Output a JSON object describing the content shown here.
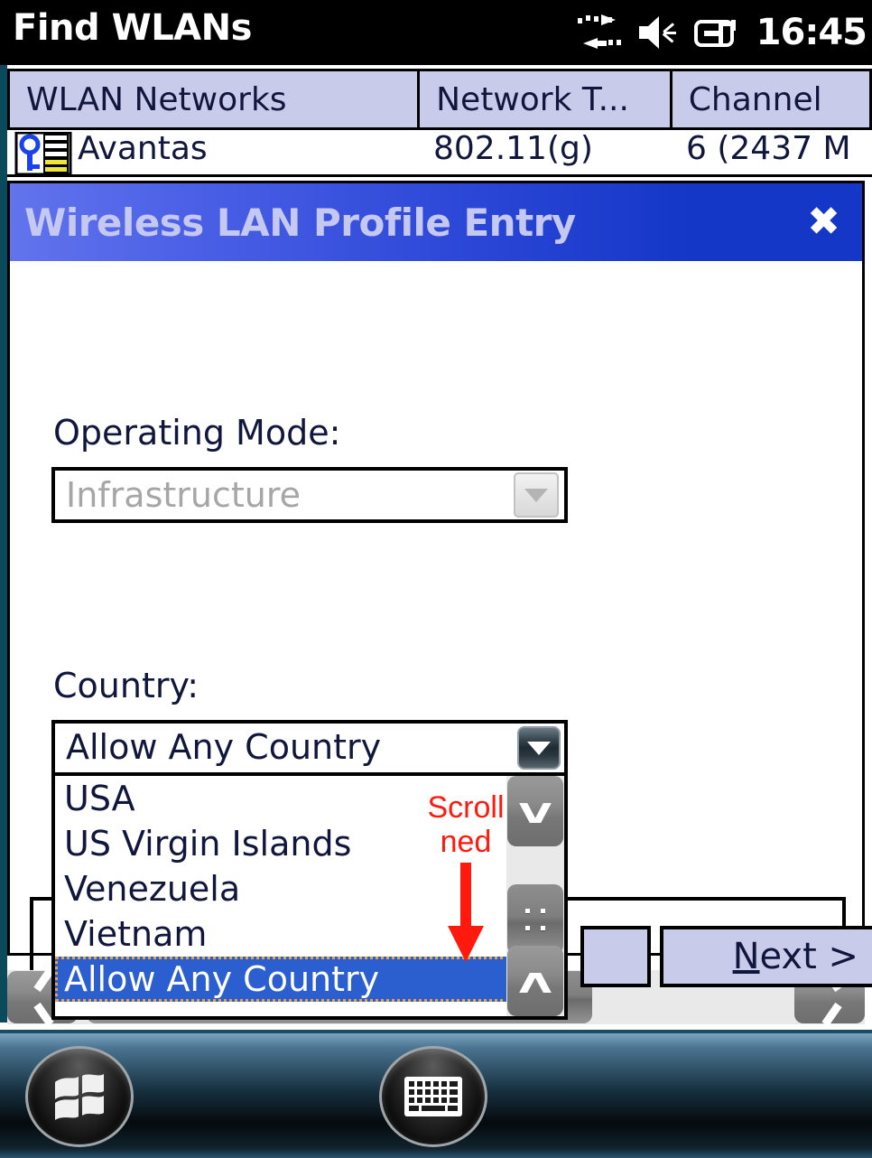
{
  "statusbar": {
    "title": "Find WLANs",
    "clock": "16:45",
    "icons": [
      "data-transfer-icon",
      "volume-speaker-icon",
      "battery-power-icon"
    ]
  },
  "app": {
    "columns": [
      "WLAN Networks",
      "Network T...",
      "Channel"
    ],
    "rows": [
      {
        "name": "Avantas",
        "network_type": "802.11(g)",
        "channel": "6 (2437 M"
      }
    ]
  },
  "dialog": {
    "title": "Wireless LAN Profile Entry",
    "close_label": "✖",
    "operating_mode": {
      "label": "Operating Mode:",
      "value": "Infrastructure",
      "disabled": true
    },
    "country": {
      "label": "Country:",
      "value": "Allow Any Country",
      "options": [
        "USA",
        "US Virgin Islands",
        "Venezuela",
        "Vietnam",
        "Allow Any Country"
      ],
      "selected": "Allow Any Country"
    },
    "buttons": {
      "back_label": "",
      "next_label_accel": "N",
      "next_label_rest": "ext >"
    }
  },
  "annotation": {
    "line1": "Scroll",
    "line2": "ned",
    "color": "#ff1a0d",
    "arrow": "down-arrow-icon"
  },
  "scrollbars": {
    "vertical": {
      "up": "chevron-up-icon",
      "down": "chevron-down-icon"
    },
    "horizontal": {
      "left": "chevron-left-icon",
      "right": "chevron-right-icon"
    }
  },
  "taskbar": {
    "start_label": "windows-logo-icon",
    "sip_label": "keyboard-icon"
  },
  "colors": {
    "titlebar_left": "#6274ec",
    "titlebar_right": "#1437c8",
    "header_fill": "#c9cbeb",
    "selection": "#2b5fd0",
    "accent_text": "#10163c",
    "annotation_red": "#ff1a0d"
  }
}
